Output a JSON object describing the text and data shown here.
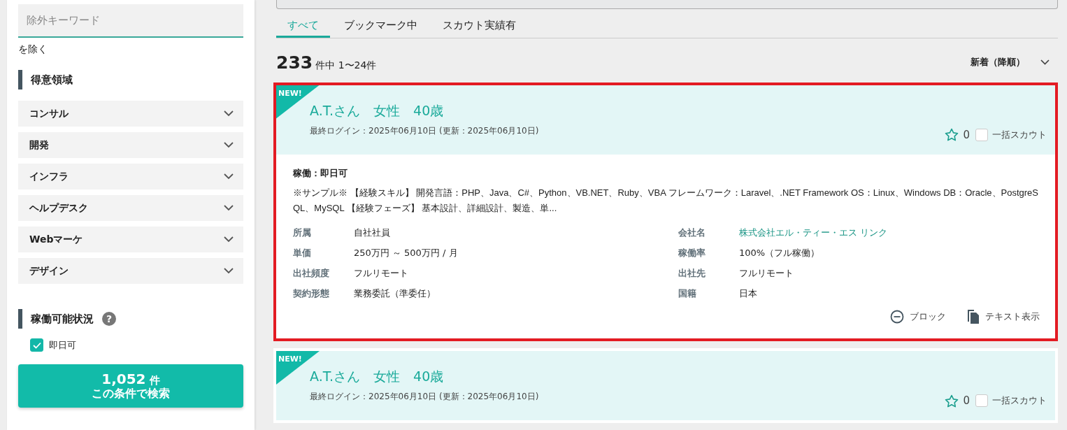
{
  "sidebar": {
    "exclude_field": {
      "placeholder": "除外キーワード"
    },
    "exclude_suffix": "を除く",
    "specialty": {
      "heading": "得意領域",
      "items": [
        {
          "label": "コンサル",
          "expanded": false
        },
        {
          "label": "開発",
          "expanded": false
        },
        {
          "label": "インフラ",
          "expanded": false
        },
        {
          "label": "ヘルプデスク",
          "expanded": false
        },
        {
          "label": "Webマーケ",
          "expanded": false
        },
        {
          "label": "デザイン",
          "expanded": false
        }
      ]
    },
    "availability": {
      "heading": "稼働可能状況",
      "help": "?",
      "options": [
        {
          "label": "即日可",
          "checked": true
        }
      ]
    },
    "search_button": {
      "count": "1,052",
      "unit": "件",
      "label": "この条件で検索"
    }
  },
  "tabs": [
    {
      "label": "すべて",
      "selected": true
    },
    {
      "label": "ブックマーク中",
      "selected": false
    },
    {
      "label": "スカウト実績有",
      "selected": false
    }
  ],
  "result_count": {
    "total": "233",
    "range": "件中 1〜24件"
  },
  "sort": {
    "label": "新着（降順）"
  },
  "cards": [
    {
      "badge": "NEW!",
      "highlighted": true,
      "name": "A.T.さん　女性　40歳",
      "login": "最終ログイン：2025年06月10日 (更新：2025年06月10日)",
      "bookmarks": "0",
      "scout_label": "一括スカウト",
      "scout_checked": false,
      "availability": "稼働：即日可",
      "summary": "※サンプル※ 【経験スキル】 開発言語：PHP、Java、C#、Python、VB.NET、Ruby、VBA フレームワーク：Laravel、.NET Framework OS：Linux、Windows DB：Oracle、PostgreSQL、MySQL 【経験フェーズ】 基本設計、詳細設計、製造、単...",
      "fields": [
        {
          "label": "所属",
          "value": "自社社員",
          "kind": "text"
        },
        {
          "label": "会社名",
          "value": "株式会社エル・ティー・エス リンク",
          "kind": "link"
        },
        {
          "label": "単価",
          "value": "250万円 ～ 500万円 / 月",
          "kind": "text"
        },
        {
          "label": "稼働率",
          "value": "100%（フル稼働）",
          "kind": "text"
        },
        {
          "label": "出社頻度",
          "value": "フルリモート",
          "kind": "text"
        },
        {
          "label": "出社先",
          "value": "フルリモート",
          "kind": "text"
        },
        {
          "label": "契約形態",
          "value": "業務委託（準委任）",
          "kind": "text"
        },
        {
          "label": "国籍",
          "value": "日本",
          "kind": "text"
        }
      ],
      "actions": [
        {
          "label": "ブロック",
          "kind": "block"
        },
        {
          "label": "テキスト表示",
          "kind": "text"
        }
      ]
    },
    {
      "badge": "NEW!",
      "highlighted": false,
      "name": "A.T.さん　女性　40歳",
      "login": "最終ログイン：2025年06月10日 (更新：2025年06月10日)",
      "bookmarks": "0",
      "scout_label": "一括スカウト",
      "scout_checked": false
    }
  ]
}
